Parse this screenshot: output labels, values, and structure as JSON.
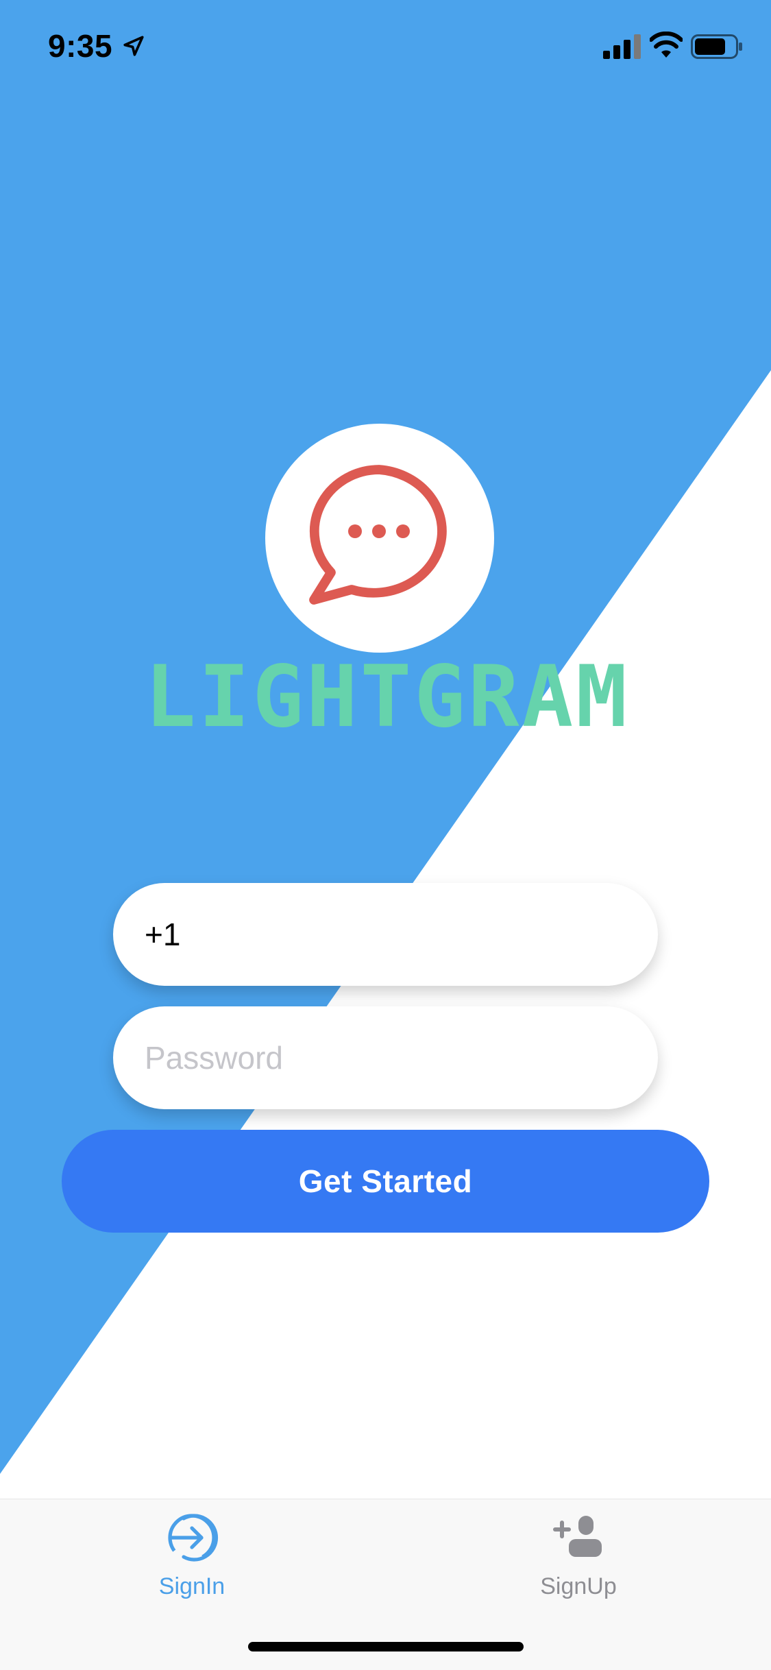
{
  "status_bar": {
    "time": "9:35",
    "icons": [
      "location-arrow-icon",
      "cellular-signal-icon",
      "wifi-icon",
      "battery-icon"
    ]
  },
  "logo": {
    "icon": "chat-bubble-icon",
    "brand": "LIGHTGRAM"
  },
  "form": {
    "phone_value": "+1",
    "password_placeholder": "Password",
    "submit_label": "Get Started"
  },
  "tab_bar": {
    "items": [
      {
        "label": "SignIn",
        "icon": "sign-in-arrow-icon",
        "active": true
      },
      {
        "label": "SignUp",
        "icon": "add-user-icon",
        "active": false
      }
    ]
  },
  "colors": {
    "background_blue": "#4BA3EC",
    "button_blue": "#3579F3",
    "brand_green": "#66D3AC",
    "chat_icon_red": "#DD5A52",
    "tab_active": "#4A9FE8",
    "tab_inactive": "#8E8E93"
  }
}
